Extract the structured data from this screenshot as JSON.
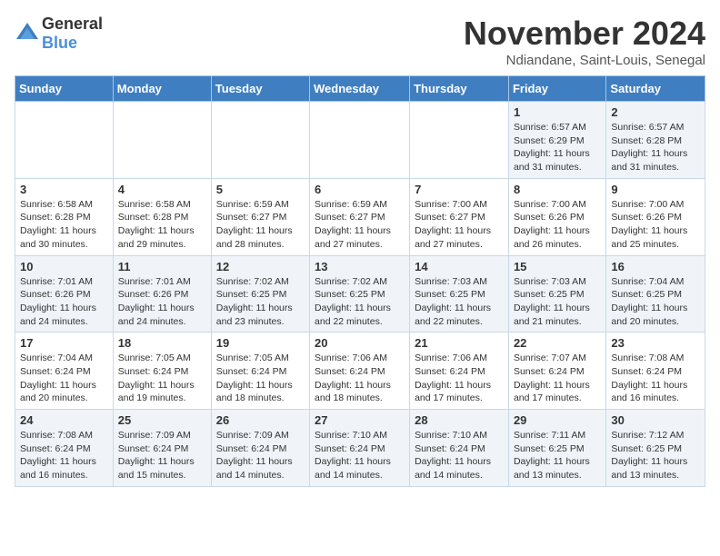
{
  "logo": {
    "general": "General",
    "blue": "Blue"
  },
  "title": "November 2024",
  "subtitle": "Ndiandane, Saint-Louis, Senegal",
  "days_of_week": [
    "Sunday",
    "Monday",
    "Tuesday",
    "Wednesday",
    "Thursday",
    "Friday",
    "Saturday"
  ],
  "weeks": [
    [
      {
        "day": "",
        "info": ""
      },
      {
        "day": "",
        "info": ""
      },
      {
        "day": "",
        "info": ""
      },
      {
        "day": "",
        "info": ""
      },
      {
        "day": "",
        "info": ""
      },
      {
        "day": "1",
        "info": "Sunrise: 6:57 AM\nSunset: 6:29 PM\nDaylight: 11 hours and 31 minutes."
      },
      {
        "day": "2",
        "info": "Sunrise: 6:57 AM\nSunset: 6:28 PM\nDaylight: 11 hours and 31 minutes."
      }
    ],
    [
      {
        "day": "3",
        "info": "Sunrise: 6:58 AM\nSunset: 6:28 PM\nDaylight: 11 hours and 30 minutes."
      },
      {
        "day": "4",
        "info": "Sunrise: 6:58 AM\nSunset: 6:28 PM\nDaylight: 11 hours and 29 minutes."
      },
      {
        "day": "5",
        "info": "Sunrise: 6:59 AM\nSunset: 6:27 PM\nDaylight: 11 hours and 28 minutes."
      },
      {
        "day": "6",
        "info": "Sunrise: 6:59 AM\nSunset: 6:27 PM\nDaylight: 11 hours and 27 minutes."
      },
      {
        "day": "7",
        "info": "Sunrise: 7:00 AM\nSunset: 6:27 PM\nDaylight: 11 hours and 27 minutes."
      },
      {
        "day": "8",
        "info": "Sunrise: 7:00 AM\nSunset: 6:26 PM\nDaylight: 11 hours and 26 minutes."
      },
      {
        "day": "9",
        "info": "Sunrise: 7:00 AM\nSunset: 6:26 PM\nDaylight: 11 hours and 25 minutes."
      }
    ],
    [
      {
        "day": "10",
        "info": "Sunrise: 7:01 AM\nSunset: 6:26 PM\nDaylight: 11 hours and 24 minutes."
      },
      {
        "day": "11",
        "info": "Sunrise: 7:01 AM\nSunset: 6:26 PM\nDaylight: 11 hours and 24 minutes."
      },
      {
        "day": "12",
        "info": "Sunrise: 7:02 AM\nSunset: 6:25 PM\nDaylight: 11 hours and 23 minutes."
      },
      {
        "day": "13",
        "info": "Sunrise: 7:02 AM\nSunset: 6:25 PM\nDaylight: 11 hours and 22 minutes."
      },
      {
        "day": "14",
        "info": "Sunrise: 7:03 AM\nSunset: 6:25 PM\nDaylight: 11 hours and 22 minutes."
      },
      {
        "day": "15",
        "info": "Sunrise: 7:03 AM\nSunset: 6:25 PM\nDaylight: 11 hours and 21 minutes."
      },
      {
        "day": "16",
        "info": "Sunrise: 7:04 AM\nSunset: 6:25 PM\nDaylight: 11 hours and 20 minutes."
      }
    ],
    [
      {
        "day": "17",
        "info": "Sunrise: 7:04 AM\nSunset: 6:24 PM\nDaylight: 11 hours and 20 minutes."
      },
      {
        "day": "18",
        "info": "Sunrise: 7:05 AM\nSunset: 6:24 PM\nDaylight: 11 hours and 19 minutes."
      },
      {
        "day": "19",
        "info": "Sunrise: 7:05 AM\nSunset: 6:24 PM\nDaylight: 11 hours and 18 minutes."
      },
      {
        "day": "20",
        "info": "Sunrise: 7:06 AM\nSunset: 6:24 PM\nDaylight: 11 hours and 18 minutes."
      },
      {
        "day": "21",
        "info": "Sunrise: 7:06 AM\nSunset: 6:24 PM\nDaylight: 11 hours and 17 minutes."
      },
      {
        "day": "22",
        "info": "Sunrise: 7:07 AM\nSunset: 6:24 PM\nDaylight: 11 hours and 17 minutes."
      },
      {
        "day": "23",
        "info": "Sunrise: 7:08 AM\nSunset: 6:24 PM\nDaylight: 11 hours and 16 minutes."
      }
    ],
    [
      {
        "day": "24",
        "info": "Sunrise: 7:08 AM\nSunset: 6:24 PM\nDaylight: 11 hours and 16 minutes."
      },
      {
        "day": "25",
        "info": "Sunrise: 7:09 AM\nSunset: 6:24 PM\nDaylight: 11 hours and 15 minutes."
      },
      {
        "day": "26",
        "info": "Sunrise: 7:09 AM\nSunset: 6:24 PM\nDaylight: 11 hours and 14 minutes."
      },
      {
        "day": "27",
        "info": "Sunrise: 7:10 AM\nSunset: 6:24 PM\nDaylight: 11 hours and 14 minutes."
      },
      {
        "day": "28",
        "info": "Sunrise: 7:10 AM\nSunset: 6:24 PM\nDaylight: 11 hours and 14 minutes."
      },
      {
        "day": "29",
        "info": "Sunrise: 7:11 AM\nSunset: 6:25 PM\nDaylight: 11 hours and 13 minutes."
      },
      {
        "day": "30",
        "info": "Sunrise: 7:12 AM\nSunset: 6:25 PM\nDaylight: 11 hours and 13 minutes."
      }
    ]
  ]
}
